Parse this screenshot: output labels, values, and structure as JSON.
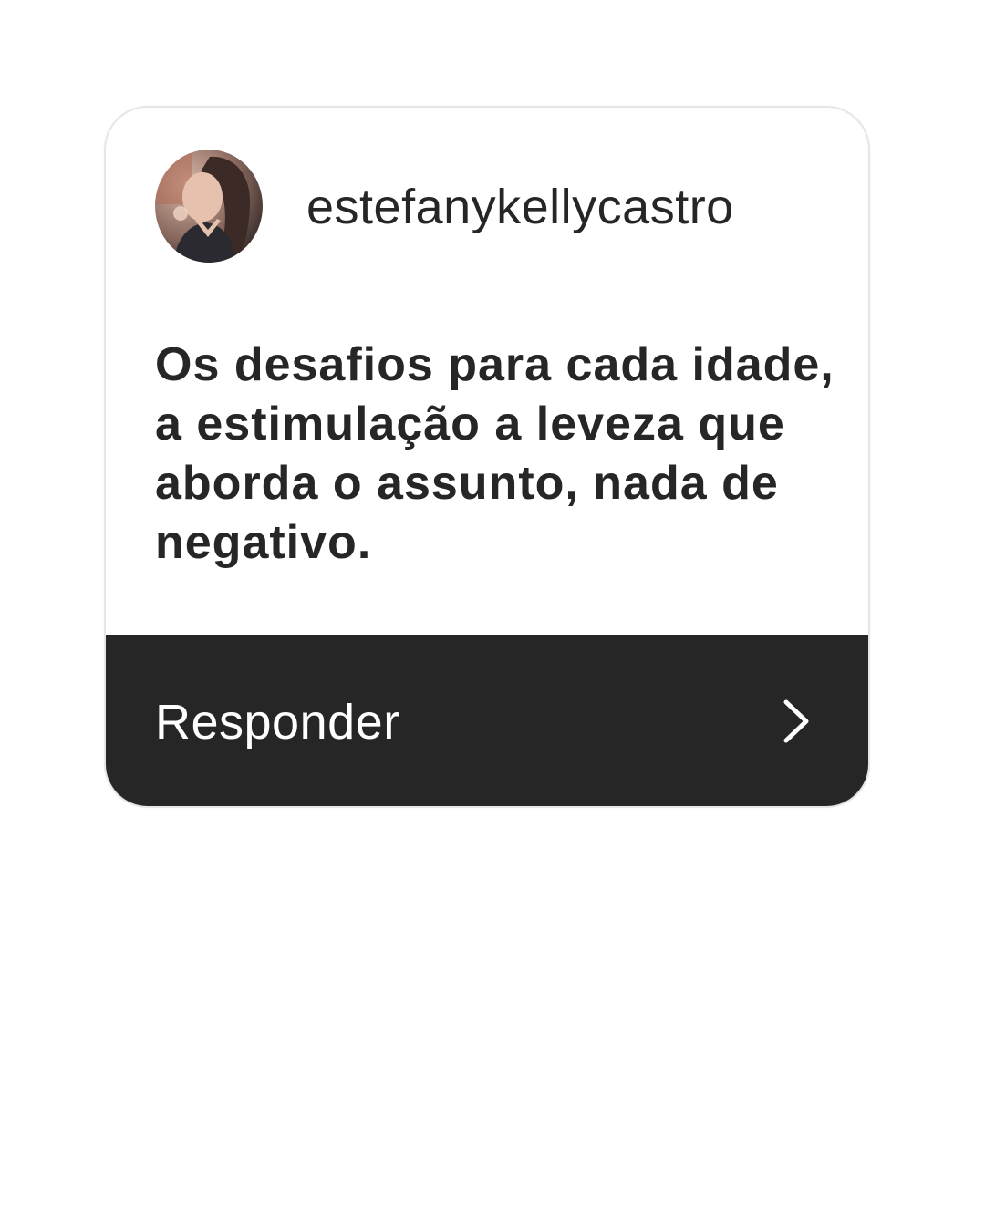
{
  "card": {
    "username": "estefanykellycastro",
    "message": "Os desafios para cada idade, a estimulação a leveza que aborda o assunto, nada de negativo.",
    "reply_label": "Responder"
  },
  "icons": {
    "avatar": "profile-photo",
    "chevron": "chevron-right-icon"
  },
  "colors": {
    "reply_bar": "#262626",
    "text": "#262626",
    "reply_text": "#ffffff"
  }
}
